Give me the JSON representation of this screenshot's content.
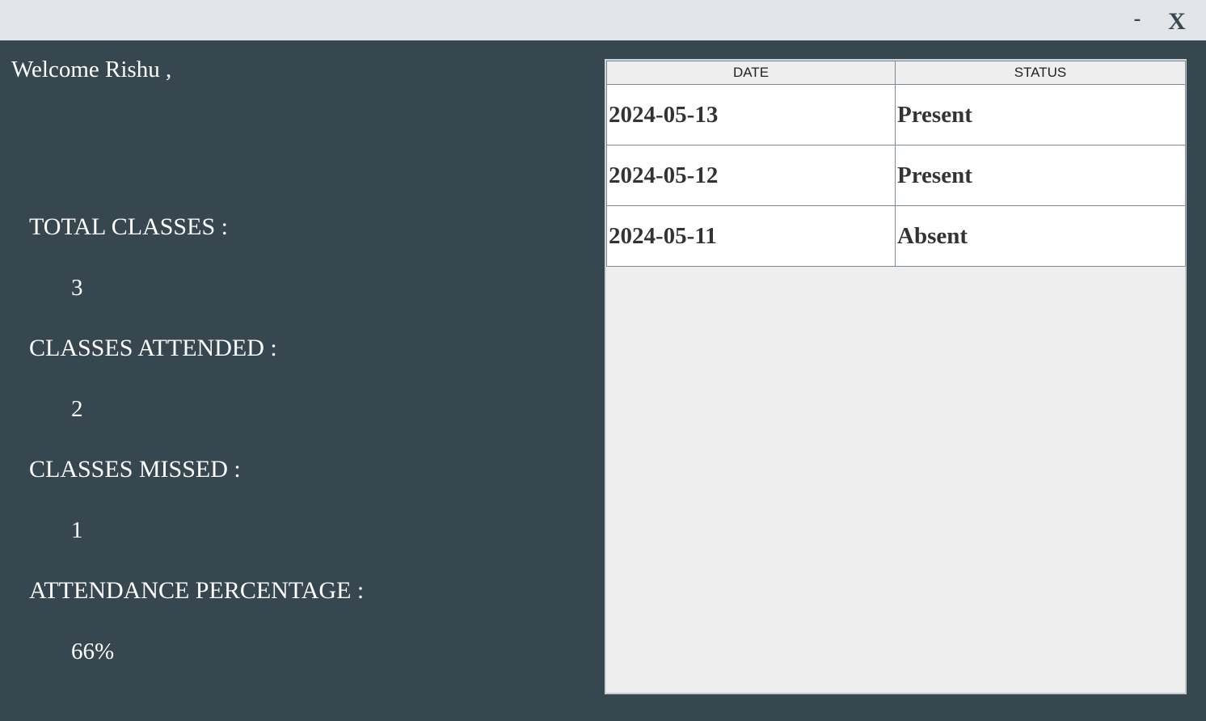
{
  "titlebar": {
    "minimize_label": "-",
    "close_label": "X"
  },
  "welcome_text": "Welcome Rishu ,",
  "stats": {
    "total_classes_label": "TOTAL CLASSES :",
    "total_classes_value": "3",
    "attended_label": "CLASSES ATTENDED :",
    "attended_value": "2",
    "missed_label": "CLASSES MISSED :",
    "missed_value": "1",
    "percentage_label": "ATTENDANCE PERCENTAGE :",
    "percentage_value": "66%"
  },
  "table": {
    "columns": [
      "DATE",
      "STATUS"
    ],
    "rows": [
      [
        "2024-05-13",
        "Present"
      ],
      [
        "2024-05-12",
        "Present"
      ],
      [
        "2024-05-11",
        "Absent"
      ]
    ]
  },
  "colors": {
    "background": "#37474f",
    "titlebar": "#e1e4e8",
    "table_empty_area": "#eeeeee",
    "cell_background": "#ffffff"
  }
}
